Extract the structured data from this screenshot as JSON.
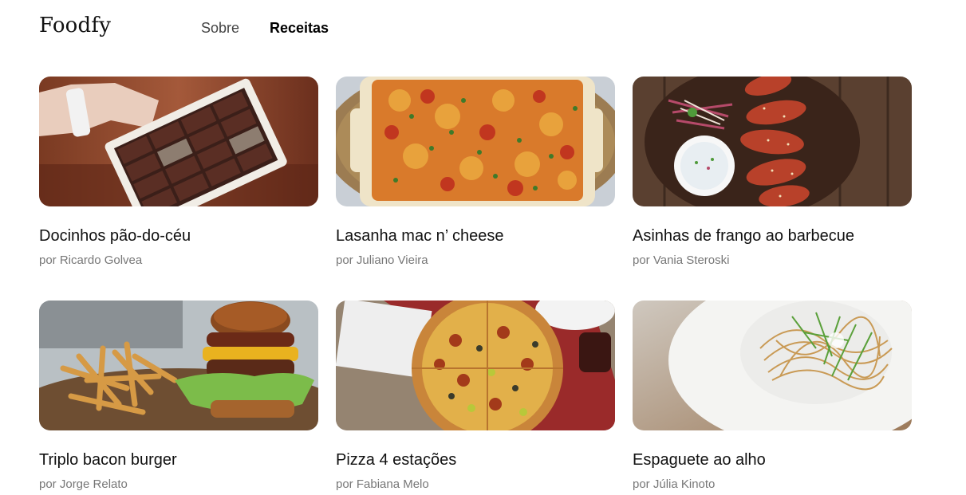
{
  "header": {
    "logo": "Foodfy",
    "nav": [
      {
        "label": "Sobre"
      },
      {
        "label": "Receitas"
      }
    ]
  },
  "recipes": [
    {
      "title": "Docinhos pão-do-céu",
      "author": "por Ricardo Golvea",
      "image": "chocolate-box-photo"
    },
    {
      "title": "Lasanha mac n’ cheese",
      "author": "por Juliano Vieira",
      "image": "lasagna-photo"
    },
    {
      "title": "Asinhas de frango ao barbecue",
      "author": "por Vania Steroski",
      "image": "bbq-wings-photo"
    },
    {
      "title": "Triplo bacon burger",
      "author": "por Jorge Relato",
      "image": "burger-photo"
    },
    {
      "title": "Pizza 4 estações",
      "author": "por Fabiana Melo",
      "image": "pizza-photo"
    },
    {
      "title": "Espaguete ao alho",
      "author": "por Júlia Kinoto",
      "image": "spaghetti-photo"
    }
  ]
}
